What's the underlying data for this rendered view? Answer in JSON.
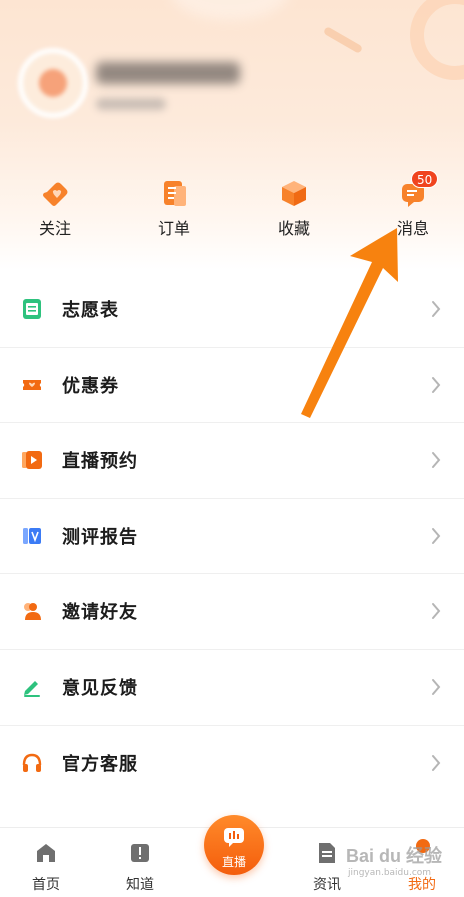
{
  "quick_actions": [
    {
      "label": "关注",
      "icon": "heart-tag-icon"
    },
    {
      "label": "订单",
      "icon": "order-doc-icon"
    },
    {
      "label": "收藏",
      "icon": "box-icon"
    },
    {
      "label": "消息",
      "icon": "message-icon",
      "badge": "50"
    }
  ],
  "menu": [
    {
      "label": "志愿表",
      "icon": "form-icon"
    },
    {
      "label": "优惠券",
      "icon": "coupon-icon"
    },
    {
      "label": "直播预约",
      "icon": "video-icon"
    },
    {
      "label": "测评报告",
      "icon": "report-icon"
    },
    {
      "label": "邀请好友",
      "icon": "invite-icon"
    },
    {
      "label": "意见反馈",
      "icon": "feedback-pen-icon"
    },
    {
      "label": "官方客服",
      "icon": "headset-icon"
    }
  ],
  "tabs": [
    {
      "label": "首页",
      "icon": "home-icon"
    },
    {
      "label": "知道",
      "icon": "book-icon"
    },
    {
      "label": "直播",
      "icon": "live-icon"
    },
    {
      "label": "资讯",
      "icon": "news-icon"
    },
    {
      "label": "我的",
      "icon": "profile-icon",
      "active": true
    }
  ],
  "watermark": {
    "main": "Bai du 经验",
    "sub": "jingyan.baidu.com"
  },
  "colors": {
    "accent": "#f26a12",
    "badge": "#f0441f",
    "arrow": "#f7820f"
  }
}
